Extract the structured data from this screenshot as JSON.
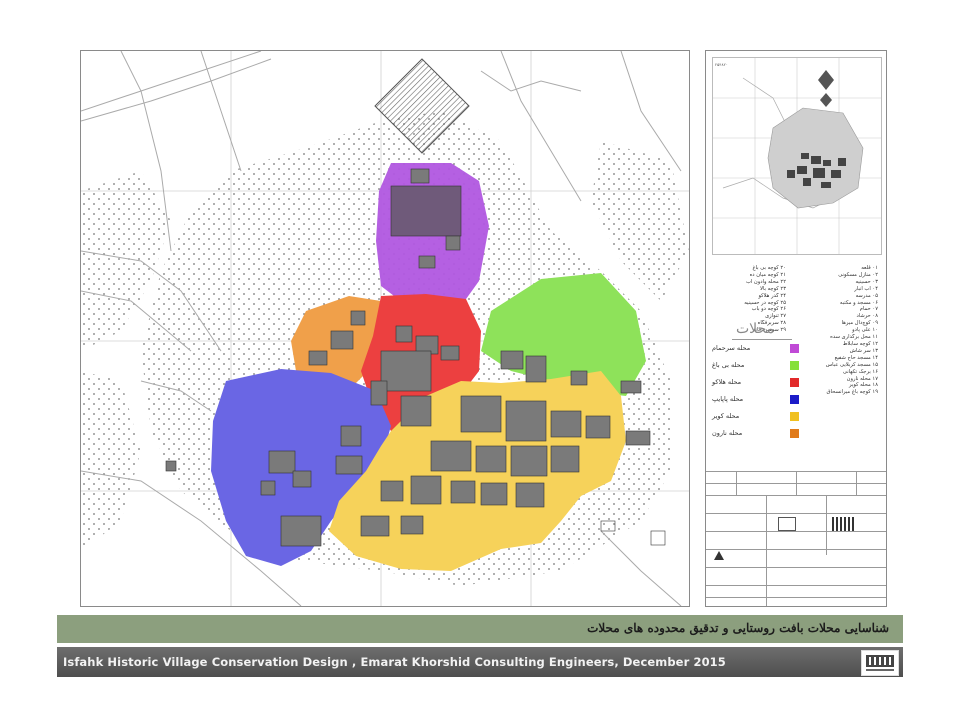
{
  "landmarks": [
    "۰۱ قلعه",
    "۰۲ منازل مسکونی",
    "۰۳ حسینیه",
    "۰۴ آب انبار",
    "۰۵ مدرسه",
    "۰۶ مسجد و مکتبه",
    "۰۷ حمام",
    "۰۸ حرشاد",
    "۰۹ کوچ‌دال میرها",
    "۱۰ علی پادو",
    "۱۱ محل برگذاری سده",
    "۱۲ کوچه سابلاط",
    "۱۳ سر شاش",
    "۱۴ مسجد حاج شفیع",
    "۱۵ مسجد کربلایی عباس",
    "۱۶ برجک تکهانی",
    "۱۷ محله نارون",
    "۱۸ محله کویر",
    "۱۹ کوچه باغ میرانسحاق",
    "۲۰ کوچه بی باغ",
    "۲۱ کوچه میان ده",
    "۲۲ محله وادون آب",
    "۲۳ کوچه بالا",
    "۲۴ گذر هلاکو",
    "۲۵ کوچه در حسینیه",
    "۲۶ کوچه دو باب",
    "۲۷ ثنوازی",
    "۲۸ سربرفگاه",
    "۲۹ سوسن خانه"
  ],
  "legend": {
    "title": "محلات",
    "items": [
      {
        "label": "محله سرحمام",
        "color": "#c04ad6"
      },
      {
        "label": "محله بی باغ",
        "color": "#86e03a"
      },
      {
        "label": "محله هلاکو",
        "color": "#e22a2a"
      },
      {
        "label": "محله پاپایپ",
        "color": "#1c1cc8"
      },
      {
        "label": "محله کویر",
        "color": "#f0c020"
      },
      {
        "label": "محله نارون",
        "color": "#e07a1a"
      }
    ]
  },
  "banner_text": "شناسایی محلات بافت روستایی و تدقیق محدوده های محلات",
  "footer_text": "Isfahk Historic Village Conservation Design , Emarat Khorshid Consulting Engineers, December 2015",
  "neighborhood_colors": {
    "sar_hammam": "#b157e0",
    "bi_bagh": "#8ee25a",
    "halaku": "#ec4040",
    "papayip": "#6a66e4",
    "kavir": "#f6d25a",
    "narvan": "#f0a04a"
  }
}
